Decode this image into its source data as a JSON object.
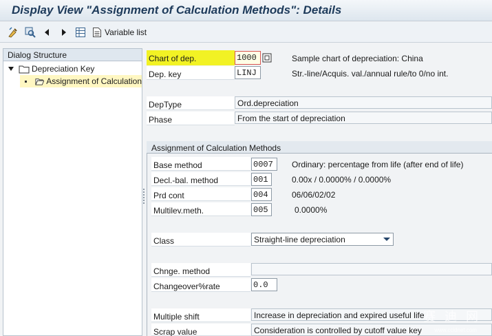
{
  "window": {
    "title": "Display View \"Assignment of Calculation Methods\": Details"
  },
  "toolbar": {
    "variable_list_label": "Variable list"
  },
  "dialog_structure": {
    "header": "Dialog Structure",
    "items": [
      {
        "label": "Depreciation Key",
        "level": 1,
        "selected": false
      },
      {
        "label": "Assignment of Calculation",
        "level": 2,
        "selected": true
      }
    ]
  },
  "keys": {
    "chart_of_dep": {
      "label": "Chart of dep.",
      "value": "1000",
      "description": "Sample chart of depreciation: China"
    },
    "dep_key": {
      "label": "Dep. key",
      "value": "LINJ",
      "description": "Str.-line/Acquis. val./annual rule/to 0/no int."
    }
  },
  "dep_info": {
    "dep_type": {
      "label": "DepType",
      "value": "Ord.depreciation"
    },
    "phase": {
      "label": "Phase",
      "value": "From the start of depreciation"
    }
  },
  "assignment": {
    "title": "Assignment of Calculation Methods",
    "base_method": {
      "label": "Base method",
      "value": "0007",
      "description": "Ordinary: percentage from life (after end of life)"
    },
    "decl_bal_method": {
      "label": "Decl.-bal. method",
      "value": "001",
      "description": "0.00x / 0.0000% / 0.0000%"
    },
    "prd_cont": {
      "label": "Prd cont",
      "value": "004",
      "description": "06/06/02/02"
    },
    "multilev_meth": {
      "label": "Multilev.meth.",
      "value": "005",
      "description": "0.0000%"
    },
    "class": {
      "label": "Class",
      "value": "Straight-line depreciation"
    },
    "chnge_method": {
      "label": "Chnge. method",
      "value": ""
    },
    "changeover_rate": {
      "label": "Changeover%rate",
      "value": "0.0"
    },
    "multiple_shift": {
      "label": "Multiple shift",
      "value": "Increase in depreciation and expired useful life"
    },
    "scrap_value": {
      "label": "Scrap value",
      "value": "Consideration is controlled by cutoff value key"
    }
  },
  "colors": {
    "highlight": "#f2f224",
    "title_text": "#1d3a5a",
    "selected_row": "#fff7c2"
  },
  "watermark": {
    "text": "赛 迪 网",
    "sub": "www.ccidnet.com"
  }
}
